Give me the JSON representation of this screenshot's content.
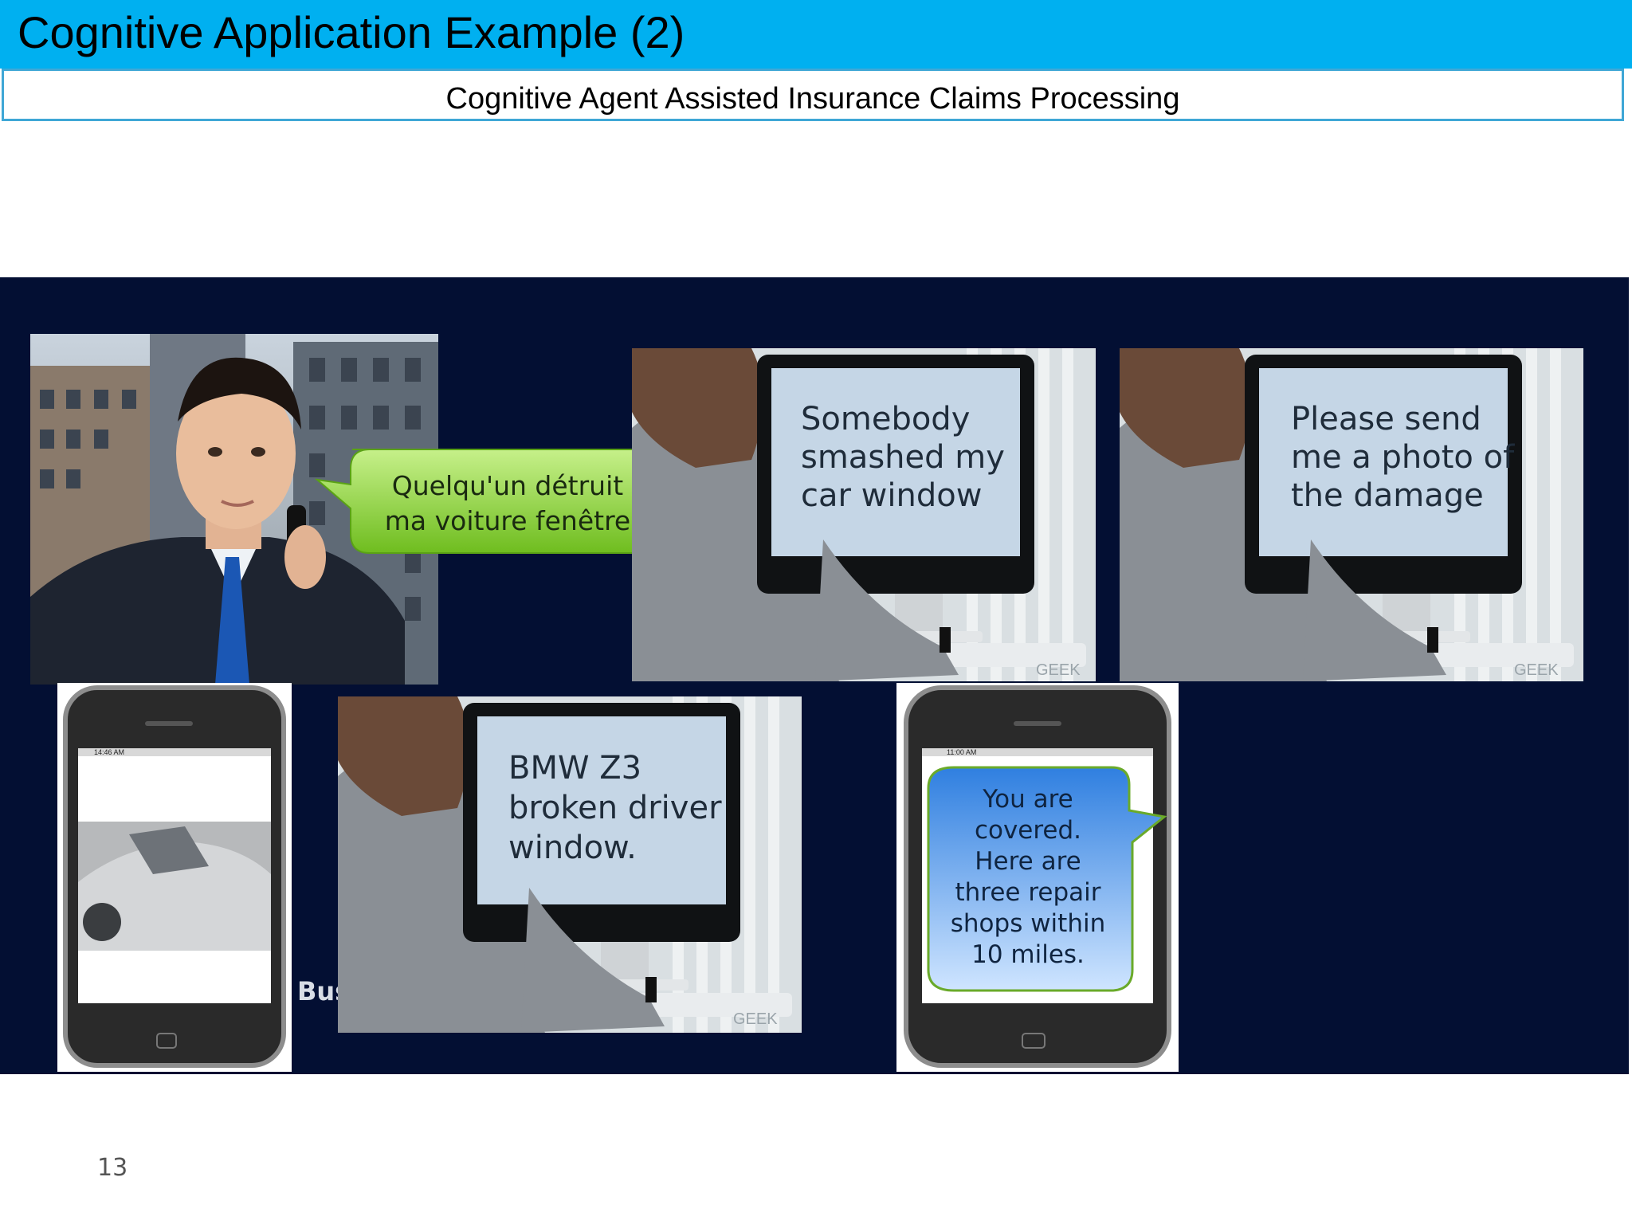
{
  "slide": {
    "title": "Cognitive Application Example (2)",
    "subtitle": "Cognitive Agent  Assisted Insurance Claims Processing",
    "page_number": "13"
  },
  "panel1": {
    "speech": [
      "Quelqu'un détruit",
      "ma voiture fenêtre"
    ]
  },
  "panel2": {
    "screen": [
      "Somebody",
      "smashed my",
      "car window"
    ],
    "watermark": "GEEK"
  },
  "panel3": {
    "screen": [
      "Please send",
      "me a photo of",
      "the damage"
    ],
    "watermark": "GEEK"
  },
  "panel4": {
    "status": "14:46 AM"
  },
  "panel5": {
    "screen": [
      "BMW Z3",
      "broken driver",
      "window."
    ],
    "watermark": "GEEK",
    "side_text": "Bus"
  },
  "panel6": {
    "status": "11:00 AM",
    "message": [
      "You are",
      "covered.",
      "Here are",
      "three repair",
      "shops within",
      "10 miles."
    ]
  },
  "colors": {
    "title_bar": "#00b0f0",
    "panel_bg": "#030f33",
    "bubble_green": "#8ed435",
    "bubble_blue": "#4f93e8"
  }
}
